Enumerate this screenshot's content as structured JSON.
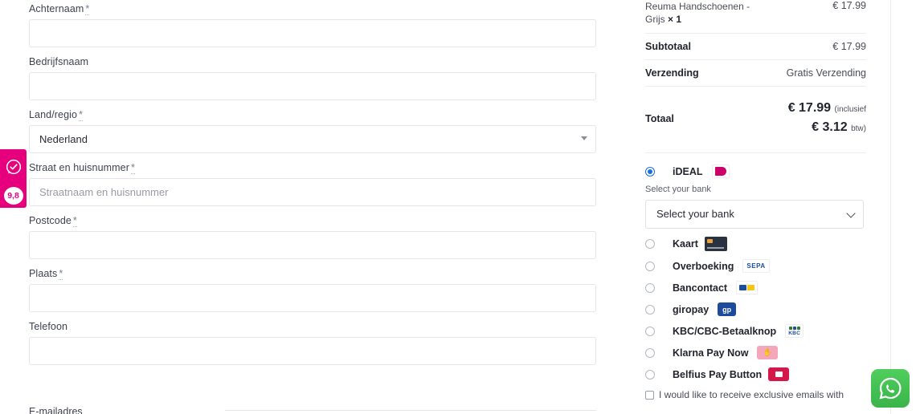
{
  "billing": {
    "fields": [
      {
        "label": "Achternaam",
        "required": true,
        "type": "text",
        "value": "",
        "placeholder": "",
        "name": "lastname"
      },
      {
        "label": "Bedrijfsnaam",
        "required": false,
        "type": "text",
        "value": "",
        "placeholder": "",
        "name": "company"
      },
      {
        "label": "Land/regio",
        "required": true,
        "type": "select",
        "value": "Nederland",
        "placeholder": "",
        "name": "country"
      },
      {
        "label": "Straat en huisnummer",
        "required": true,
        "type": "text",
        "value": "",
        "placeholder": "Straatnaam en huisnummer",
        "name": "address"
      },
      {
        "label": "Postcode",
        "required": true,
        "type": "text",
        "value": "",
        "placeholder": "",
        "name": "postcode"
      },
      {
        "label": "Plaats",
        "required": true,
        "type": "text",
        "value": "",
        "placeholder": "",
        "name": "city"
      },
      {
        "label": "Telefoon",
        "required": false,
        "type": "text",
        "value": "",
        "placeholder": "",
        "name": "phone"
      }
    ],
    "required_marker": "*",
    "cut_off_label": "E-mailadres"
  },
  "review_badge": {
    "score": "9,8",
    "icon": "check-circle-icon",
    "color": "#e6007e"
  },
  "summary": {
    "product": {
      "name": "Reuma Handschoenen - Grijs",
      "quantity_label": "× 1",
      "price": "€ 17.99"
    },
    "subtotal": {
      "label": "Subtotaal",
      "value": "€ 17.99"
    },
    "shipping": {
      "label": "Verzending",
      "value": "Gratis Verzending"
    },
    "total": {
      "label": "Totaal",
      "amount": "€ 17.99",
      "amount_note": "(inclusief",
      "tax_amount": "€ 3.12",
      "tax_note": "btw)"
    }
  },
  "payment": {
    "selected": "ideal",
    "bank_section_label": "Select your bank",
    "bank_select_value": "Select your bank",
    "methods": [
      {
        "id": "ideal",
        "label": "iDEAL",
        "logo": "ideal-logo",
        "checked": true
      },
      {
        "id": "card",
        "label": "Kaart",
        "logo": "card-logo",
        "checked": false
      },
      {
        "id": "sepa",
        "label": "Overboeking",
        "logo": "sepa-logo",
        "logo_text": "SEPA",
        "checked": false
      },
      {
        "id": "bancontact",
        "label": "Bancontact",
        "logo": "bancontact-logo",
        "checked": false
      },
      {
        "id": "giropay",
        "label": "giropay",
        "logo": "giropay-logo",
        "logo_text": "gp",
        "checked": false
      },
      {
        "id": "kbc",
        "label": "KBC/CBC-Betaalknop",
        "logo": "kbc-logo",
        "logo_text": "KBC",
        "checked": false
      },
      {
        "id": "klarna",
        "label": "Klarna Pay Now",
        "logo": "klarna-logo",
        "checked": false
      },
      {
        "id": "belfius",
        "label": "Belfius Pay Button",
        "logo": "belfius-logo",
        "checked": false
      }
    ],
    "email_optin": "I would like to receive exclusive emails with"
  },
  "whatsapp": {
    "icon": "whatsapp-icon",
    "color": "#3ab44a"
  }
}
